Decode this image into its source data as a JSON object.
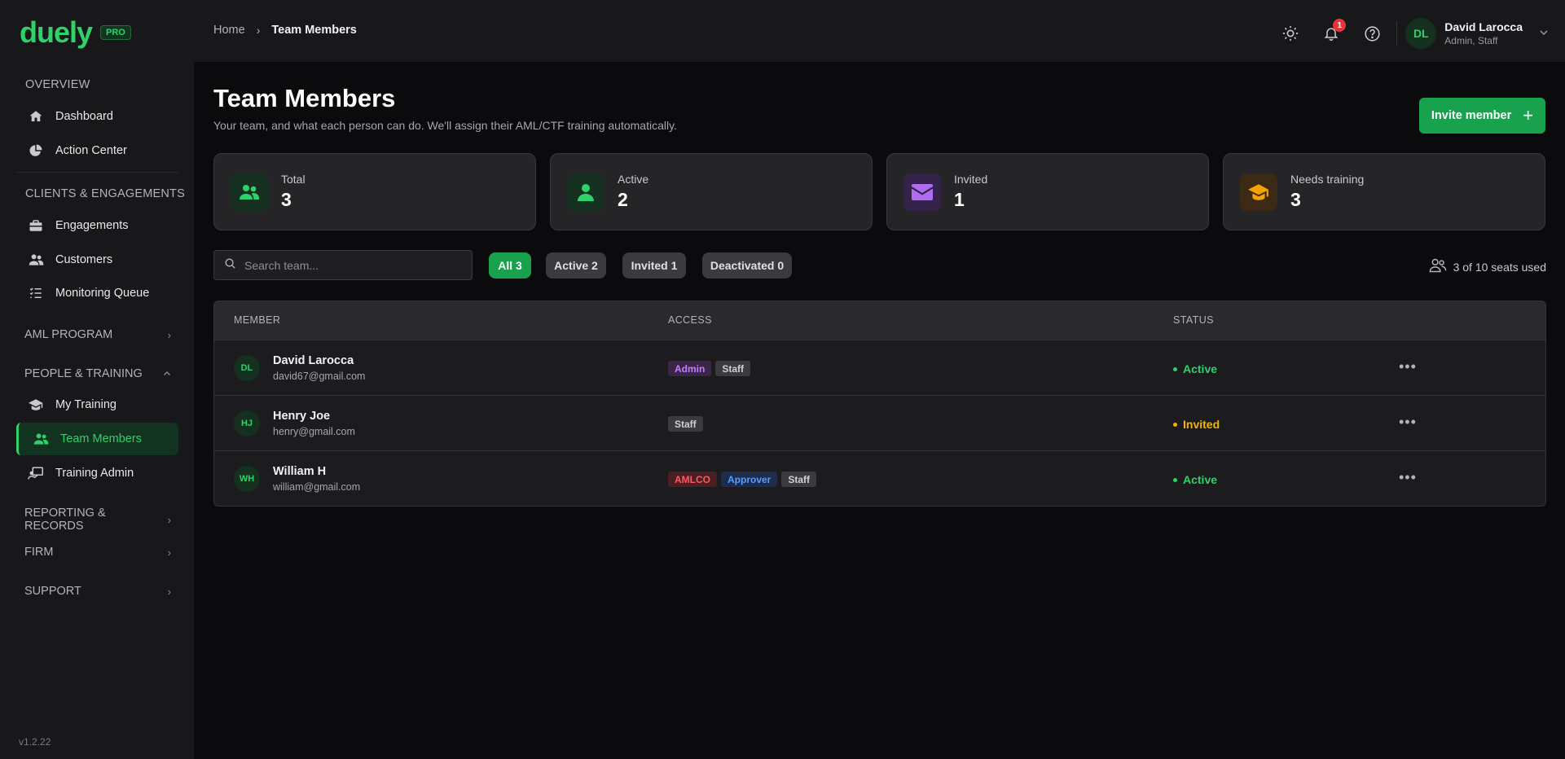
{
  "brand": {
    "logo": "duely",
    "badge": "PRO"
  },
  "sidebar": {
    "overview_label": "OVERVIEW",
    "dashboard": "Dashboard",
    "action_center": "Action Center",
    "clients_label": "CLIENTS & ENGAGEMENTS",
    "engagements": "Engagements",
    "customers": "Customers",
    "monitoring": "Monitoring Queue",
    "aml_program": "AML PROGRAM",
    "people_training": "PEOPLE & TRAINING",
    "my_training": "My Training",
    "team_members": "Team Members",
    "training_admin": "Training Admin",
    "reporting": "REPORTING & RECORDS",
    "firm": "FIRM",
    "support": "SUPPORT",
    "version": "v1.2.22"
  },
  "header": {
    "breadcrumb_home": "Home",
    "breadcrumb_sep": "›",
    "breadcrumb_current": "Team Members",
    "notification_count": "1",
    "user_initials": "DL",
    "user_name": "David Larocca",
    "user_role": "Admin, Staff"
  },
  "page": {
    "title": "Team Members",
    "subtitle": "Your team, and what each person can do. We'll assign their AML/CTF training automatically.",
    "invite_button": "Invite member",
    "invite_plus": "+"
  },
  "stats": [
    {
      "label": "Total",
      "value": "3",
      "icon": "users-icon",
      "color": "#2fd26a"
    },
    {
      "label": "Active",
      "value": "2",
      "icon": "user-icon",
      "color": "#2fd26a"
    },
    {
      "label": "Invited",
      "value": "1",
      "icon": "envelope-icon",
      "color": "#b06cf0"
    },
    {
      "label": "Needs training",
      "value": "3",
      "icon": "graduation-cap-icon",
      "color": "#f5a300"
    }
  ],
  "filters": {
    "search_placeholder": "Search team...",
    "chips": [
      "All 3",
      "Active 2",
      "Invited 1",
      "Deactivated 0"
    ],
    "seats": "3 of 10 seats used"
  },
  "table": {
    "headers": [
      "MEMBER",
      "ACCESS",
      "STATUS"
    ],
    "rows": [
      {
        "initials": "DL",
        "name": "David Larocca",
        "email": "david67@gmail.com",
        "tags": [
          "Admin",
          "Staff"
        ],
        "status": "Active"
      },
      {
        "initials": "HJ",
        "name": "Henry Joe",
        "email": "henry@gmail.com",
        "tags": [
          "Staff"
        ],
        "status": "Invited"
      },
      {
        "initials": "WH",
        "name": "William H",
        "email": "william@gmail.com",
        "tags": [
          "AMLCO",
          "Approver",
          "Staff"
        ],
        "status": "Active"
      }
    ],
    "more": "•••"
  },
  "colors": {
    "accent": "#2fd26a",
    "primary_button": "#19a24d",
    "invited": "#f5b400"
  }
}
